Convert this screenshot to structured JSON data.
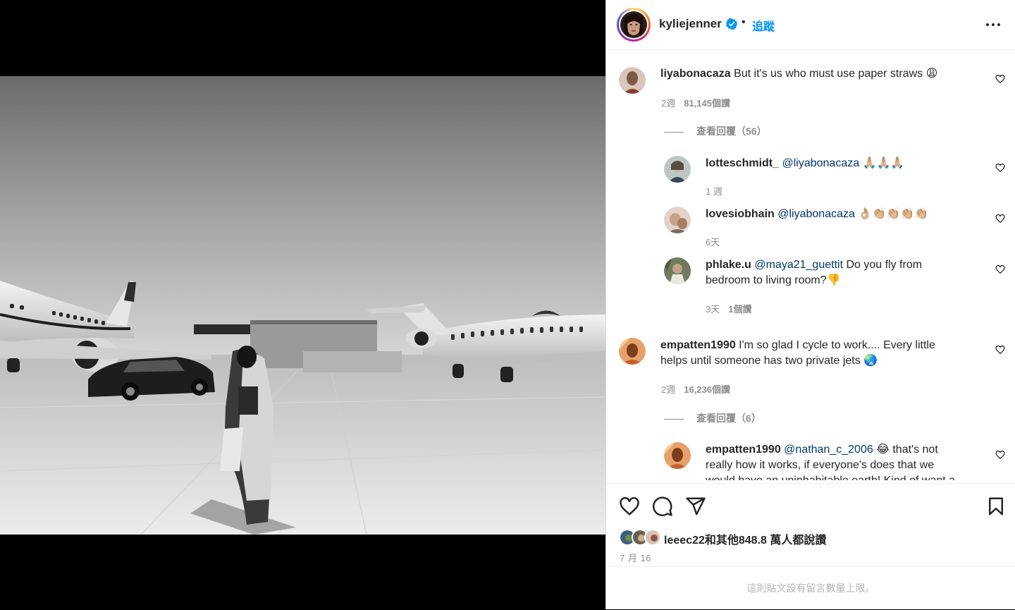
{
  "post": {
    "author": "kyliejenner",
    "dot": "•",
    "follow_label": "追蹤",
    "more_icon": "more-horizontal-icon",
    "verified_color": "#0095f6"
  },
  "comments": [
    {
      "user": "liyabonacaza",
      "mention": "",
      "text": "But it's us who must use paper straws 😩",
      "age": "2週",
      "likes": "81,145個讚",
      "view_replies": "查看回覆（56）"
    },
    {
      "user": "lotteschmidt_",
      "mention": "@liyabonacaza",
      "text": "🙏🏼🙏🏼🙏🏼",
      "age": "1 週",
      "likes": ""
    },
    {
      "user": "lovesiobhain",
      "mention": "@liyabonacaza",
      "text": "👌🏼👏🏼👏🏼👏🏼👏🏼",
      "age": "6天",
      "likes": ""
    },
    {
      "user": "phlake.u",
      "mention": "@maya21_guettit",
      "text": "Do you fly from",
      "text2": "bedroom to living room?👎",
      "age": "3天",
      "likes": "1個讚"
    },
    {
      "user": "empatten1990",
      "mention": "",
      "text": "I'm so glad I cycle to work.... Every little",
      "text2": "helps until someone has two private jets 🌏",
      "age": "2週",
      "likes": "16,236個讚",
      "view_replies": "查看回覆（6）"
    },
    {
      "user": "empatten1990",
      "mention": "@nathan_c_2006",
      "text": "😂 that's not",
      "text2": "really how it works, if everyone's does that we",
      "text3": "would have an uninhabitable earth! Kind of want a"
    }
  ],
  "actions": {
    "like_icon": "heart-icon",
    "comment_icon": "comment-icon",
    "share_icon": "paper-plane-icon",
    "save_icon": "bookmark-icon",
    "likes_text": "leeec22和其他848.8 萬人都說讚",
    "date": "7 月 16"
  },
  "footer_text": "這則貼文設有留言數量上限。"
}
